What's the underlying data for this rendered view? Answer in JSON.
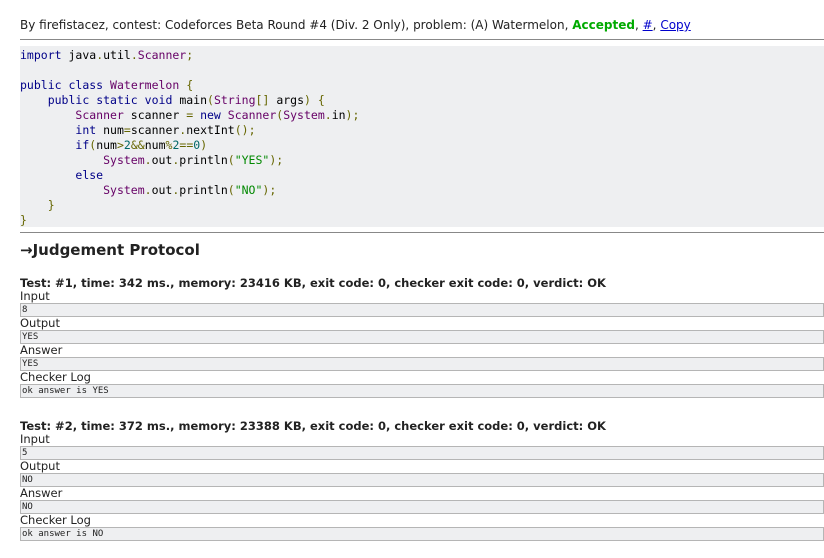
{
  "header": {
    "prefix": "By firefistacez, contest: Codeforces Beta Round #4 (Div. 2 Only), problem: (A) Watermelon,",
    "verdict": "Accepted",
    "comma1": ",",
    "hash_link": "#",
    "comma2": ",",
    "copy_link": "Copy"
  },
  "code": {
    "lines": [
      "import java.util.Scanner;",
      "",
      "public class Watermelon {",
      "    public static void main(String[] args) {",
      "        Scanner scanner = new Scanner(System.in);",
      "        int num=scanner.nextInt();",
      "        if(num>2&&num%2==0)",
      "            System.out.println(\"YES\");",
      "        else",
      "            System.out.println(\"NO\");",
      "    }",
      "}"
    ]
  },
  "protocol": {
    "title": "→Judgement Protocol",
    "tests": [
      {
        "title": "Test: #1, time: 342 ms., memory: 23416 KB, exit code: 0, checker exit code: 0, verdict: OK",
        "input_label": "Input",
        "input": "8",
        "output_label": "Output",
        "output": "YES",
        "answer_label": "Answer",
        "answer": "YES",
        "checker_label": "Checker Log",
        "checker": "ok answer is YES"
      },
      {
        "title": "Test: #2, time: 372 ms., memory: 23388 KB, exit code: 0, checker exit code: 0, verdict: OK",
        "input_label": "Input",
        "input": "5",
        "output_label": "Output",
        "output": "NO",
        "answer_label": "Answer",
        "answer": "NO",
        "checker_label": "Checker Log",
        "checker": "ok answer is NO"
      }
    ]
  },
  "colors": {
    "accepted": "#00aa00",
    "link": "#0000cc",
    "code_bg": "#eeeff1",
    "keyword": "#000088",
    "type": "#660066",
    "string": "#008800",
    "number": "#006666",
    "punct": "#666600"
  }
}
